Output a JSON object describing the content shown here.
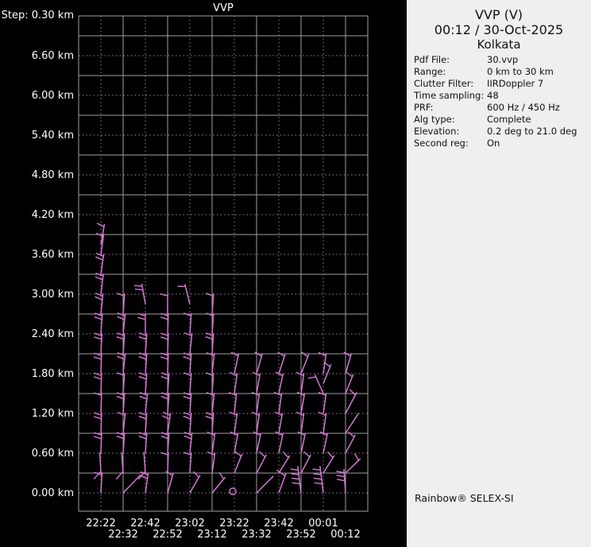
{
  "left_pane": {
    "title": "VVP",
    "step_label": "Step: 0.30 km"
  },
  "info_panel": {
    "title": "VVP (V)",
    "datetime": "00:12 / 30-Oct-2025",
    "site": "Kolkata",
    "rows": [
      {
        "label": "Pdf File:",
        "value": "30.vvp"
      },
      {
        "label": "Range:",
        "value": "0 km to 30 km"
      },
      {
        "label": "Clutter Filter:",
        "value": "IIRDoppler 7"
      },
      {
        "label": "Time sampling:",
        "value": "48"
      },
      {
        "label": "PRF:",
        "value": "600 Hz / 450 Hz"
      },
      {
        "label": "Alg type:",
        "value": "Complete"
      },
      {
        "label": "Elevation:",
        "value": "0.2 deg to 21.0 deg"
      },
      {
        "label": "Second reg:",
        "value": "On"
      }
    ],
    "footer": "Rainbow® SELEX-SI"
  },
  "chart_data": {
    "type": "wind-barb-time-height-profile",
    "title": "VVP",
    "step_label": "Step: 0.30 km",
    "step_km": 0.3,
    "ylabel": "altitude",
    "xlabel": "time",
    "ylim_km": [
      -0.28,
      7.2
    ],
    "grid": "on",
    "altitude_ticks": [
      "6.60 km",
      "6.00 km",
      "5.40 km",
      "4.80 km",
      "4.20 km",
      "3.60 km",
      "3.00 km",
      "2.40 km",
      "1.80 km",
      "1.20 km",
      "0.60 km",
      "0.00 km"
    ],
    "time_ticks_row1": [
      "22:22",
      "22:42",
      "23:02",
      "23:22",
      "23:42",
      "00:01"
    ],
    "time_ticks_row2": [
      "22:32",
      "22:52",
      "23:12",
      "23:32",
      "23:52",
      "00:12"
    ],
    "times": [
      "22:22",
      "22:32",
      "22:42",
      "22:52",
      "23:02",
      "23:12",
      "23:22",
      "23:32",
      "23:42",
      "23:52",
      "00:01",
      "00:12"
    ],
    "colors": {
      "background": "#000000",
      "grid_solid": "#a0a0a0",
      "grid_dotted": "#8f8f8f",
      "plot_text": "#ffffff",
      "barb": "#d678d6",
      "panel_bg": "#efeef0",
      "panel_text": "#121212"
    },
    "calm": {
      "time": "23:22",
      "km": 0.0
    },
    "columns": [
      {
        "time": "22:22",
        "barbs": [
          {
            "km": 0.0,
            "rot": 3,
            "f": 1
          },
          {
            "km": 0.3,
            "rot": -3,
            "f": 1,
            "fa": -135,
            "fr": [
              0.08
            ],
            "fl": 13
          },
          {
            "km": 0.6,
            "rot": 2,
            "f": 2
          },
          {
            "km": 0.9,
            "rot": 2,
            "f": 2
          },
          {
            "km": 1.2,
            "rot": 2,
            "f": 1
          },
          {
            "km": 1.5,
            "rot": 2,
            "f": 2
          },
          {
            "km": 1.8,
            "rot": 2,
            "f": 2
          },
          {
            "km": 2.1,
            "rot": 3,
            "f": 2
          },
          {
            "km": 2.4,
            "rot": 4,
            "f": 2
          },
          {
            "km": 2.7,
            "rot": 6,
            "f": 2
          },
          {
            "km": 3.0,
            "rot": 7,
            "f": 2
          },
          {
            "km": 3.3,
            "rot": 8,
            "f": 2
          },
          {
            "km": 3.6,
            "rot": 8,
            "f": 1
          },
          {
            "km": 3.75,
            "rot": 10,
            "f": 1
          }
        ]
      },
      {
        "time": "22:32",
        "barbs": [
          {
            "km": 0.0,
            "rot": 44,
            "f": 0,
            "len": 32
          },
          {
            "km": 0.3,
            "rot": -4,
            "f": 1,
            "fa": -135,
            "fr": [
              0.08
            ],
            "fl": 13
          },
          {
            "km": 0.6,
            "rot": 4,
            "f": 2
          },
          {
            "km": 0.9,
            "rot": 6,
            "f": 1
          },
          {
            "km": 1.2,
            "rot": 4,
            "f": 2
          },
          {
            "km": 1.5,
            "rot": 4,
            "f": 1
          },
          {
            "km": 1.8,
            "rot": 6,
            "f": 2
          },
          {
            "km": 2.1,
            "rot": 4,
            "f": 2
          },
          {
            "km": 2.4,
            "rot": 6,
            "f": 2
          },
          {
            "km": 2.7,
            "rot": 4,
            "f": 1
          }
        ]
      },
      {
        "time": "22:42",
        "barbs": [
          {
            "km": 0.0,
            "rot": 8,
            "f": 2
          },
          {
            "km": 0.3,
            "rot": -4,
            "f": 1,
            "fa": -135,
            "fr": [
              0.08
            ],
            "fl": 13
          },
          {
            "km": 0.6,
            "rot": 4,
            "f": 2
          },
          {
            "km": 0.9,
            "rot": 4,
            "f": 2
          },
          {
            "km": 1.2,
            "rot": 6,
            "f": 2
          },
          {
            "km": 1.5,
            "rot": 4,
            "f": 2
          },
          {
            "km": 1.8,
            "rot": 4,
            "f": 2
          },
          {
            "km": 2.1,
            "rot": 4,
            "f": 2
          },
          {
            "km": 2.4,
            "rot": 0,
            "f": 2
          },
          {
            "km": 2.85,
            "rot": -10,
            "f": 2
          }
        ]
      },
      {
        "time": "22:52",
        "barbs": [
          {
            "km": 0.0,
            "rot": 16,
            "f": 1
          },
          {
            "km": 0.3,
            "rot": 2,
            "f": 1
          },
          {
            "km": 0.6,
            "rot": 4,
            "f": 2
          },
          {
            "km": 0.9,
            "rot": 8,
            "f": 2
          },
          {
            "km": 1.2,
            "rot": 4,
            "f": 2
          },
          {
            "km": 1.5,
            "rot": 4,
            "f": 2
          },
          {
            "km": 1.8,
            "rot": 2,
            "f": 2
          },
          {
            "km": 2.1,
            "rot": 2,
            "f": 2
          },
          {
            "km": 2.4,
            "rot": 2,
            "f": 2
          },
          {
            "km": 2.7,
            "rot": 0,
            "f": 1
          }
        ]
      },
      {
        "time": "23:02",
        "barbs": [
          {
            "km": 0.0,
            "rot": 30,
            "f": 1
          },
          {
            "km": 0.3,
            "rot": 4,
            "f": 1
          },
          {
            "km": 0.6,
            "rot": 6,
            "f": 2
          },
          {
            "km": 0.9,
            "rot": 4,
            "f": 2
          },
          {
            "km": 1.2,
            "rot": 4,
            "f": 2
          },
          {
            "km": 1.5,
            "rot": 4,
            "f": 1
          },
          {
            "km": 1.8,
            "rot": 4,
            "f": 2
          },
          {
            "km": 2.1,
            "rot": 6,
            "f": 1
          },
          {
            "km": 2.4,
            "rot": 4,
            "f": 1
          },
          {
            "km": 2.85,
            "rot": -14,
            "f": 1
          }
        ]
      },
      {
        "time": "23:12",
        "barbs": [
          {
            "km": 0.0,
            "rot": 40,
            "f": 1
          },
          {
            "km": 0.3,
            "rot": 8,
            "f": 1
          },
          {
            "km": 0.6,
            "rot": 8,
            "f": 1
          },
          {
            "km": 0.9,
            "rot": 4,
            "f": 2
          },
          {
            "km": 1.2,
            "rot": 6,
            "f": 1
          },
          {
            "km": 1.5,
            "rot": 4,
            "f": 1
          },
          {
            "km": 1.8,
            "rot": 6,
            "f": 1
          },
          {
            "km": 2.1,
            "rot": 4,
            "f": 2
          },
          {
            "km": 2.4,
            "rot": 4,
            "f": 1
          },
          {
            "km": 2.7,
            "rot": 4,
            "f": 1
          }
        ]
      },
      {
        "time": "23:22",
        "barbs": [
          {
            "km": 0.0,
            "calm": true
          },
          {
            "km": 0.3,
            "rot": 22,
            "f": 1
          },
          {
            "km": 0.6,
            "rot": 10,
            "f": 1
          },
          {
            "km": 0.9,
            "rot": 8,
            "f": 1
          },
          {
            "km": 1.2,
            "rot": 6,
            "f": 1
          },
          {
            "km": 1.5,
            "rot": 8,
            "f": 1
          },
          {
            "km": 1.8,
            "rot": 12,
            "f": 1
          }
        ]
      },
      {
        "time": "23:32",
        "barbs": [
          {
            "km": 0.0,
            "rot": 45,
            "f": 0,
            "len": 30
          },
          {
            "km": 0.3,
            "rot": 28,
            "f": 1
          },
          {
            "km": 0.6,
            "rot": 12,
            "f": 1
          },
          {
            "km": 0.9,
            "rot": 8,
            "f": 1
          },
          {
            "km": 1.2,
            "rot": 8,
            "f": 1
          },
          {
            "km": 1.5,
            "rot": 10,
            "f": 1
          },
          {
            "km": 1.8,
            "rot": 16,
            "f": 1
          }
        ]
      },
      {
        "time": "23:42",
        "barbs": [
          {
            "km": 0.0,
            "rot": 20,
            "f": 1,
            "fl": 13
          },
          {
            "km": 0.3,
            "rot": 32,
            "f": 1
          },
          {
            "km": 0.6,
            "rot": 12,
            "f": 1
          },
          {
            "km": 0.9,
            "rot": 10,
            "f": 1
          },
          {
            "km": 1.2,
            "rot": 8,
            "f": 1
          },
          {
            "km": 1.5,
            "rot": 12,
            "f": 1
          },
          {
            "km": 1.8,
            "rot": 18,
            "f": 1
          }
        ]
      },
      {
        "time": "23:52",
        "barbs": [
          {
            "km": 0.0,
            "rot": -7,
            "f": 4,
            "len": 34
          },
          {
            "km": 0.3,
            "rot": 28,
            "f": 1
          },
          {
            "km": 0.6,
            "rot": 12,
            "f": 1
          },
          {
            "km": 0.9,
            "rot": 8,
            "f": 1
          },
          {
            "km": 1.2,
            "rot": 10,
            "f": 1
          },
          {
            "km": 1.5,
            "rot": 8,
            "f": 1
          },
          {
            "km": 1.8,
            "rot": 22,
            "f": 1
          }
        ]
      },
      {
        "time": "00:01",
        "barbs": [
          {
            "km": 0.0,
            "rot": -7,
            "f": 4,
            "len": 34
          },
          {
            "km": 0.3,
            "rot": 32,
            "f": 1
          },
          {
            "km": 0.6,
            "rot": 12,
            "f": 1
          },
          {
            "km": 0.9,
            "rot": 8,
            "f": 1
          },
          {
            "km": 1.2,
            "rot": 8,
            "f": 1
          },
          {
            "km": 1.5,
            "rot": -24,
            "f": 1
          },
          {
            "km": 1.65,
            "rot": 22,
            "f": 1
          },
          {
            "km": 1.8,
            "rot": 8,
            "f": 1
          }
        ]
      },
      {
        "time": "00:12",
        "barbs": [
          {
            "km": 0.0,
            "rot": -4,
            "f": 3,
            "len": 30
          },
          {
            "km": 0.3,
            "rot": 46,
            "f": 1
          },
          {
            "km": 0.6,
            "rot": 28,
            "f": 1
          },
          {
            "km": 0.9,
            "rot": 33,
            "f": 0,
            "len": 30
          },
          {
            "km": 1.2,
            "rot": 28,
            "f": 1,
            "len": 30
          },
          {
            "km": 1.5,
            "rot": 22,
            "f": 1
          },
          {
            "km": 1.8,
            "rot": 16,
            "f": 1
          }
        ]
      }
    ]
  }
}
